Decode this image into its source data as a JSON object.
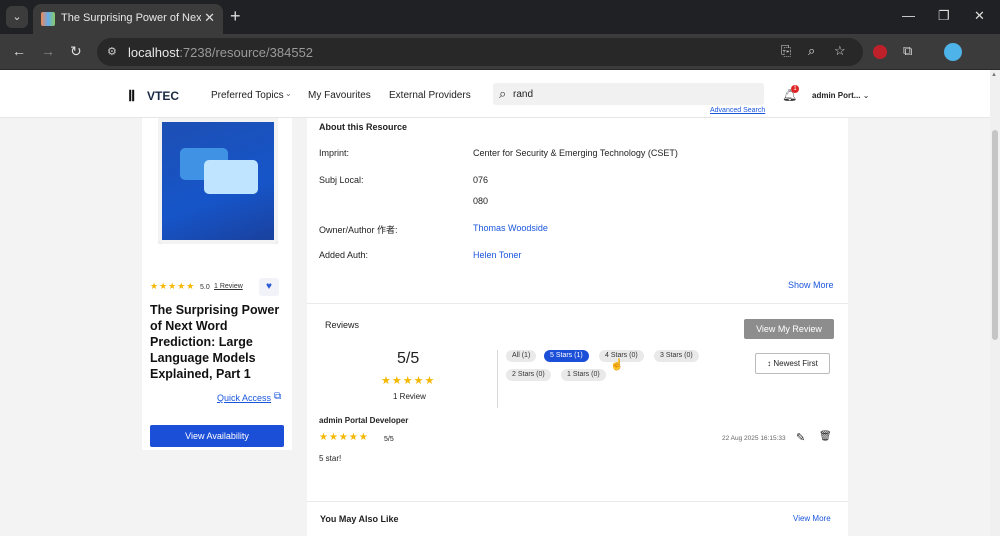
{
  "browser": {
    "tab_title": "The Surprising Power of Next Word Pr",
    "url_host": "localhost",
    "url_path": ":7238/resource/384552"
  },
  "header": {
    "logo": "VTEC",
    "nav": [
      "Preferred Topics",
      "My Favourites",
      "External Providers"
    ],
    "search_value": "rand",
    "advanced_search": "Advanced Search",
    "notification_count": "1",
    "user": "admin Port..."
  },
  "resource": {
    "rating": "5.0",
    "review_link": "1 Review",
    "title": "The Surprising Power of Next Word Prediction: Large Language Models Explained, Part 1",
    "quick_access": "Quick Access",
    "availability_button": "View Availability"
  },
  "about": {
    "title": "About this Resource",
    "rows": [
      {
        "label": "Imprint:",
        "value": "Center for Security & Emerging Technology (CSET)"
      },
      {
        "label": "Subj Local:",
        "value": "076"
      },
      {
        "label": "",
        "value": "080"
      },
      {
        "label": "Owner/Author 作者:",
        "value": "Thomas Woodside"
      },
      {
        "label": "Added Auth:",
        "value": "Helen Toner"
      }
    ],
    "show_more": "Show More"
  },
  "reviews": {
    "title": "Reviews",
    "view_my_review": "View My Review",
    "score": "5/5",
    "count_label": "1 Review",
    "filters": [
      "All (1)",
      "5 Stars (1)",
      "4 Stars (0)",
      "3 Stars (0)",
      "2 Stars (0)",
      "1 Stars (0)"
    ],
    "active_filter": "5 Stars (1)",
    "sort": "Newest First",
    "items": [
      {
        "author": "admin Portal Developer",
        "score": "5/5",
        "date": "22 Aug 2025 16:15:33",
        "text": "5 star!"
      }
    ]
  },
  "also_like": {
    "title": "You May Also Like",
    "view_more": "View More"
  },
  "colors": {
    "accent": "#1c4fd8",
    "star": "#f5b800"
  }
}
